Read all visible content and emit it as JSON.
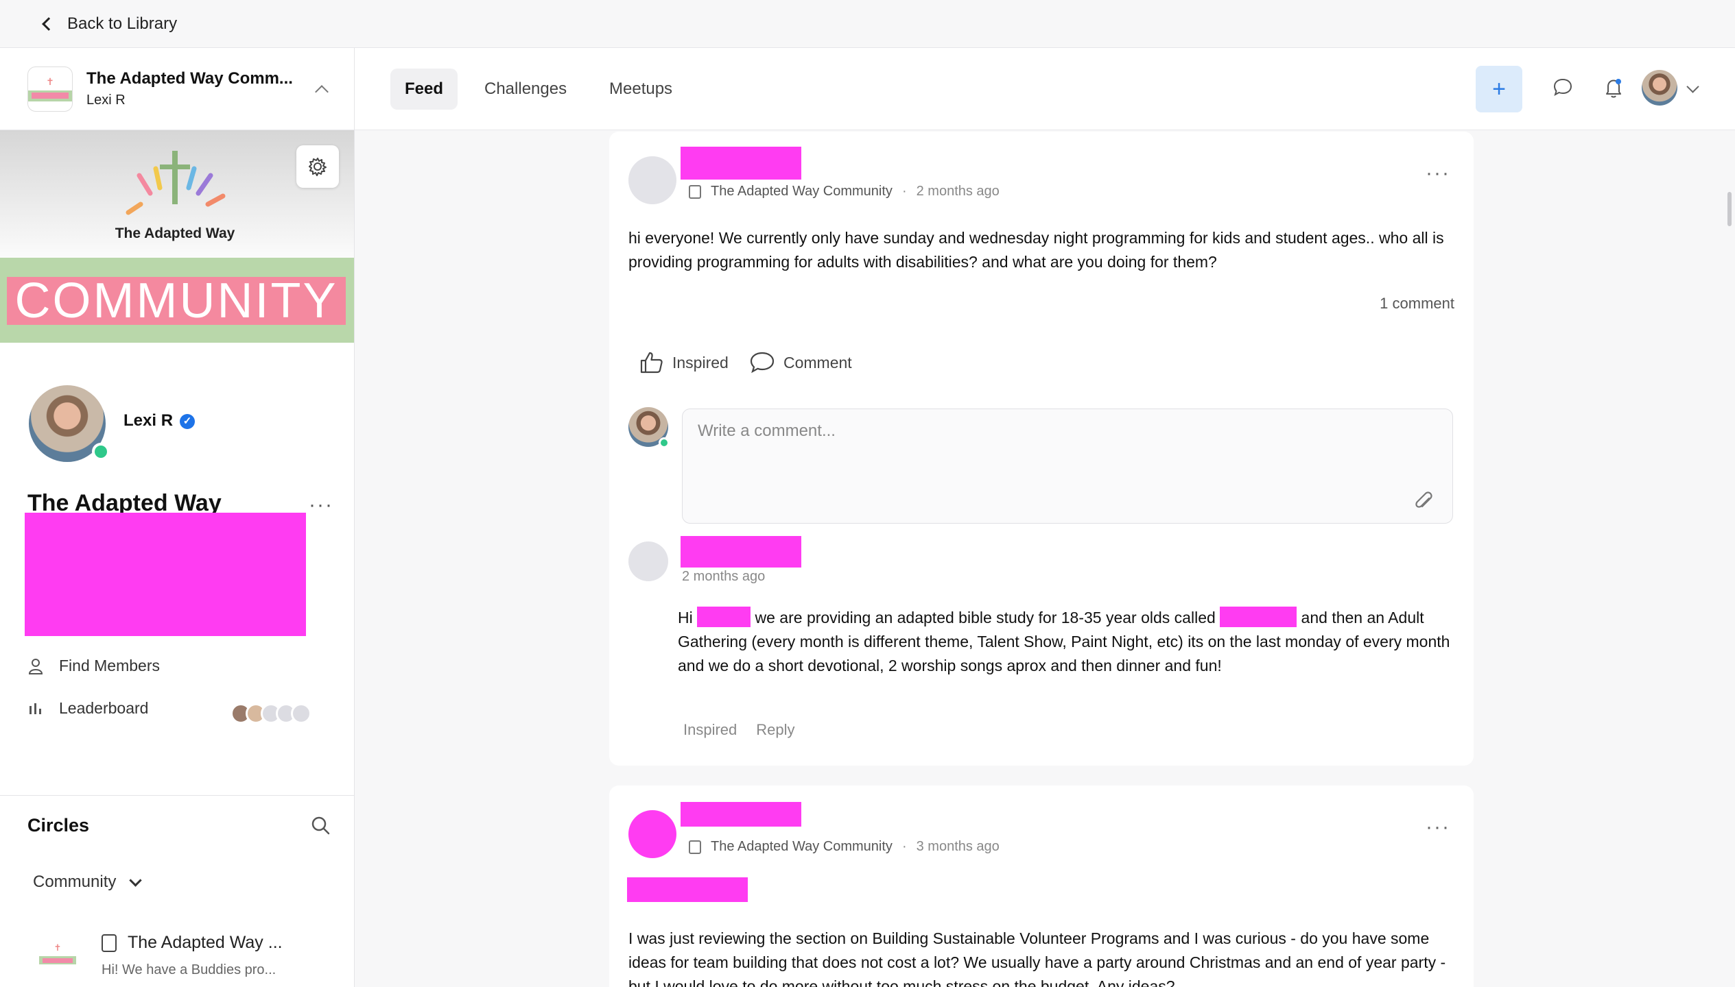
{
  "back": {
    "label": "Back to Library"
  },
  "sidebar": {
    "community_name": "The Adapted Way Comm...",
    "user_name": "Lexi R",
    "cover_title": "The Adapted Way",
    "cover_banner": "COMMUNITY",
    "profile_name": "Lexi R",
    "community_title": "The Adapted Way Community",
    "links": [
      {
        "label": "Find Members"
      },
      {
        "label": "Leaderboard"
      }
    ],
    "circles": {
      "heading": "Circles",
      "filter": "Community",
      "items": [
        {
          "title": "The Adapted Way ...",
          "snippet": "Hi! We have a Buddies pro..."
        }
      ]
    }
  },
  "nav": {
    "tabs": [
      {
        "label": "Feed",
        "active": true
      },
      {
        "label": "Challenges",
        "active": false
      },
      {
        "label": "Meetups",
        "active": false
      }
    ],
    "plus": "+"
  },
  "posts": [
    {
      "community": "The Adapted Way Community",
      "time": "2 months ago",
      "body": "hi everyone! We currently only have sunday and wednesday night programming for kids and student ages.. who all is providing programming for adults with disabilities? and what are you doing for them?",
      "comment_count": "1 comment",
      "actions": {
        "like": "Inspired",
        "comment": "Comment"
      },
      "comment_placeholder": "Write a comment...",
      "comments": [
        {
          "time": "2 months ago",
          "seg1": "Hi ",
          "seg2": " we are providing an adapted bible study for 18-35 year olds called ",
          "seg3": " and then an Adult Gathering (every month is different theme, Talent Show, Paint Night, etc) its on the last monday of every month and we do a short devotional, 2 worship songs aprox and then dinner and fun!",
          "actions": {
            "like": "Inspired",
            "reply": "Reply"
          }
        }
      ]
    },
    {
      "community": "The Adapted Way Community",
      "time": "3 months ago",
      "body": "I was just reviewing the section on Building Sustainable Volunteer Programs and I was curious - do you have some ideas for team building that does not cost a lot? We usually have a party around Christmas and an end of year party - but I would love to do more without too much stress on the budget. Any ideas?"
    }
  ],
  "colors": {
    "accent": "#2b7be4",
    "redaction": "#ff3cf2",
    "online": "#2fc88a"
  }
}
